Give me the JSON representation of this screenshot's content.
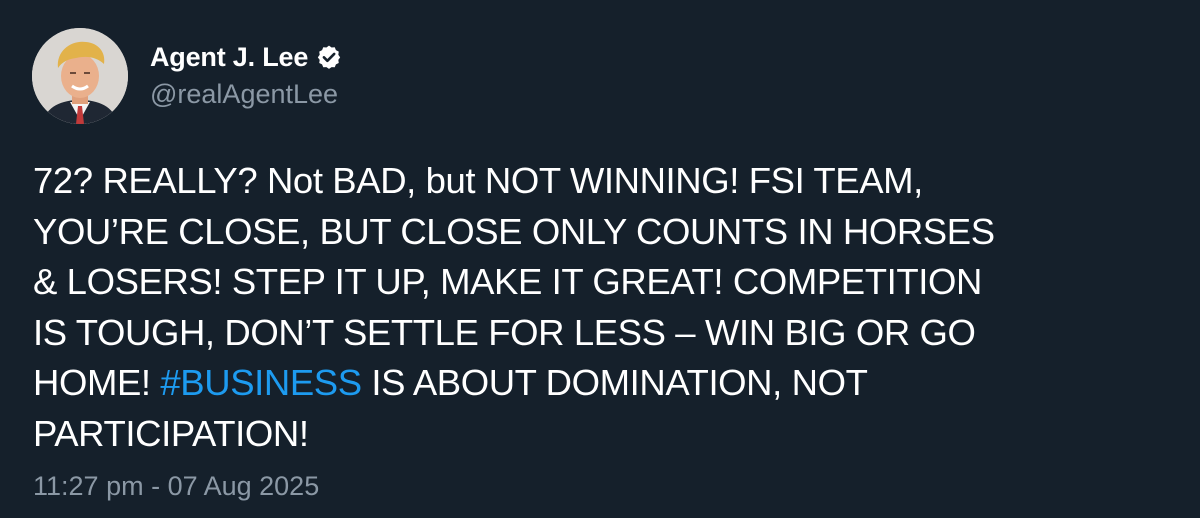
{
  "author": {
    "display_name": "Agent J. Lee",
    "handle": "@realAgentLee",
    "verified_icon": "verified-badge-icon",
    "avatar_icon": "avatar-photo"
  },
  "tweet": {
    "text_part1": "72? REALLY? Not BAD, but NOT WINNING! FSI TEAM,\nYOU’RE CLOSE, BUT CLOSE ONLY COUNTS IN HORSES\n& LOSERS! STEP IT UP, MAKE IT GREAT! COMPETITION\nIS TOUGH, DON’T SETTLE FOR LESS – WIN BIG OR GO\nHOME! ",
    "hashtag": "#BUSINESS",
    "text_part2": " IS ABOUT DOMINATION, NOT\nPARTICIPATION!",
    "timestamp": "11:27 pm - 07 Aug 2025"
  },
  "colors": {
    "background": "#15202b",
    "text": "#ffffff",
    "secondary_text": "#8b98a5",
    "hashtag": "#1d9bf0"
  }
}
